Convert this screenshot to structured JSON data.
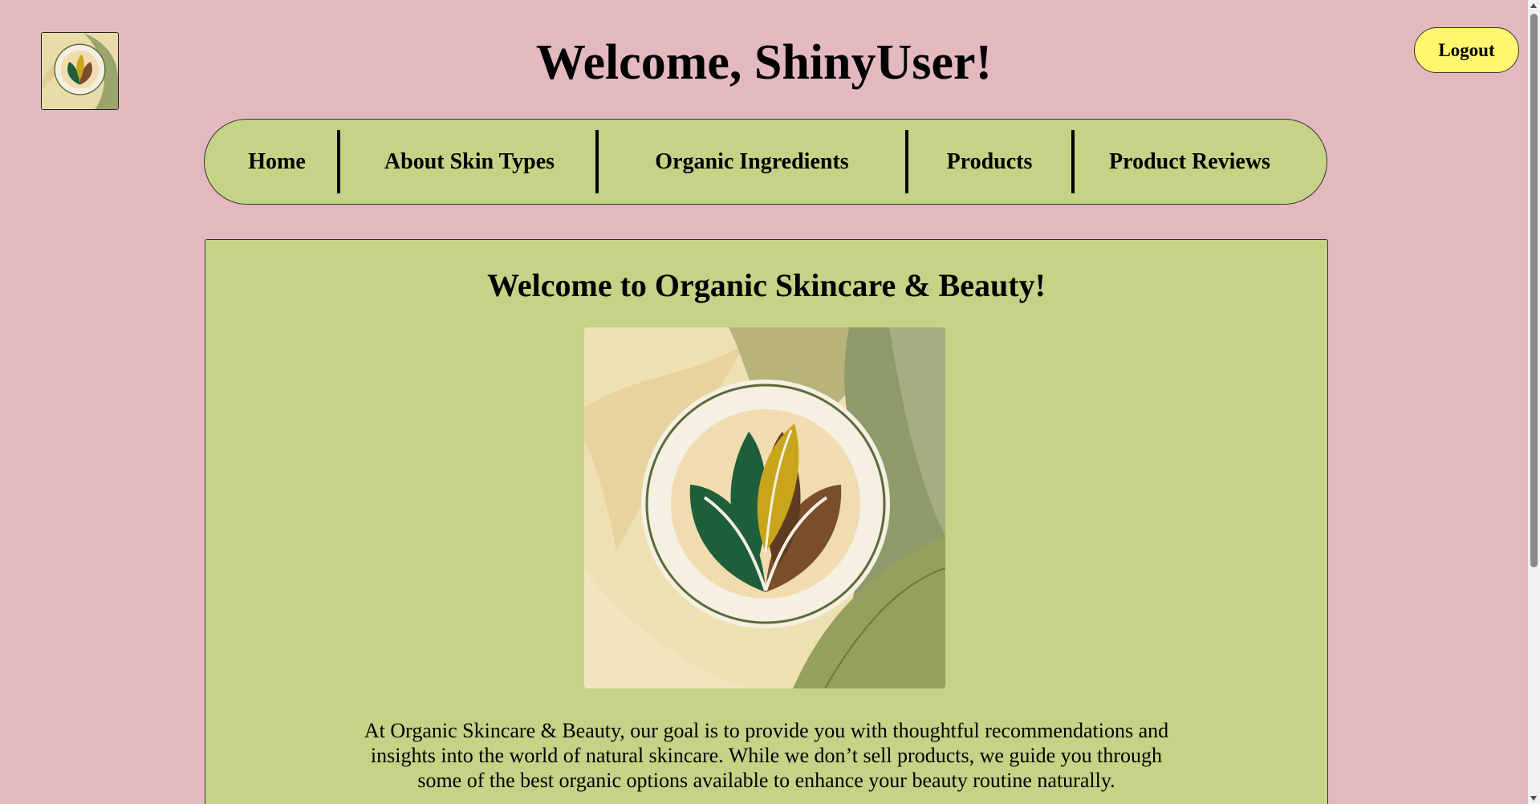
{
  "header": {
    "welcome_text": "Welcome, ShinyUser!",
    "logout_label": "Logout"
  },
  "nav": {
    "items": [
      {
        "label": "Home"
      },
      {
        "label": "About Skin Types"
      },
      {
        "label": "Organic Ingredients"
      },
      {
        "label": "Products"
      },
      {
        "label": "Product Reviews"
      }
    ]
  },
  "main": {
    "title": "Welcome to Organic Skincare & Beauty!",
    "intro": "At Organic Skincare & Beauty, our goal is to provide you with thoughtful recommendations and insights into the world of natural skincare. While we don’t sell products, we guide you through some of the best organic options available to enhance your beauty routine naturally."
  },
  "colors": {
    "page_background": "#e3b9bf",
    "nav_background": "#c4d386",
    "logout_background": "#fff76e",
    "leaf_green": "#1f5e3a",
    "leaf_brown": "#7a4e2b",
    "leaf_gold": "#c9a51c"
  },
  "icons": {
    "site_logo": "leaf-emblem-icon",
    "hero": "leaf-emblem-icon"
  }
}
